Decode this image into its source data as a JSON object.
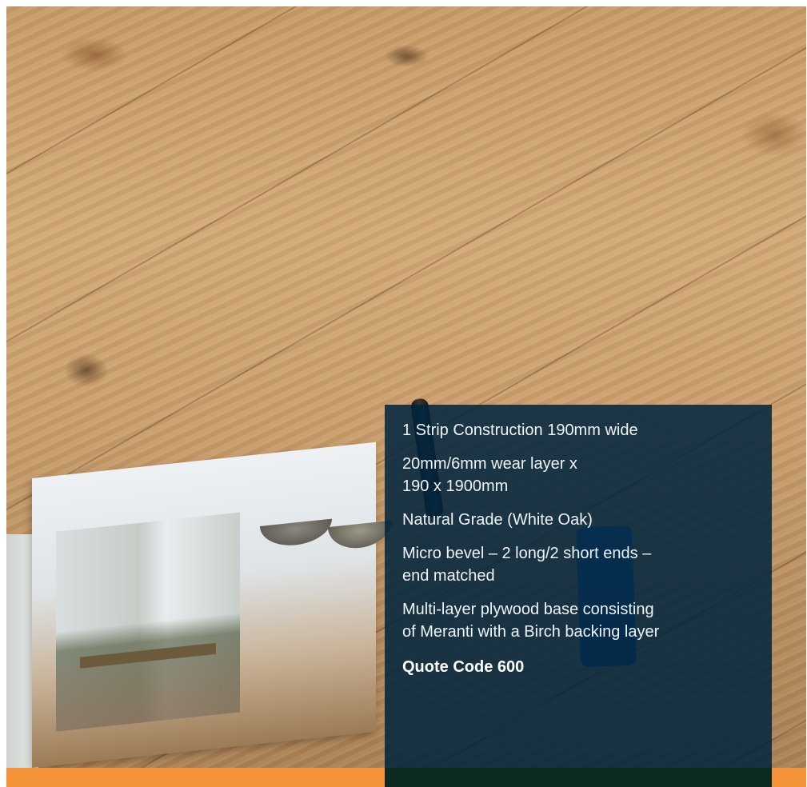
{
  "colors": {
    "overlay": "#00243e",
    "accent_bar": "#f39237",
    "bar_dark": "#0d2a20",
    "wood": "#c99d6c"
  },
  "overlay": {
    "line1": "1 Strip Construction 190mm wide",
    "line2a": "20mm/6mm wear layer x",
    "line2b": "190 x 1900mm",
    "line3": "Natural Grade (White Oak)",
    "line4a": "Micro bevel – 2 long/2 short ends –",
    "line4b": "end matched",
    "line5a": "Multi-layer plywood base consisting",
    "line5b": "of Meranti with a Birch backing layer",
    "quote": "Quote Code 600"
  }
}
